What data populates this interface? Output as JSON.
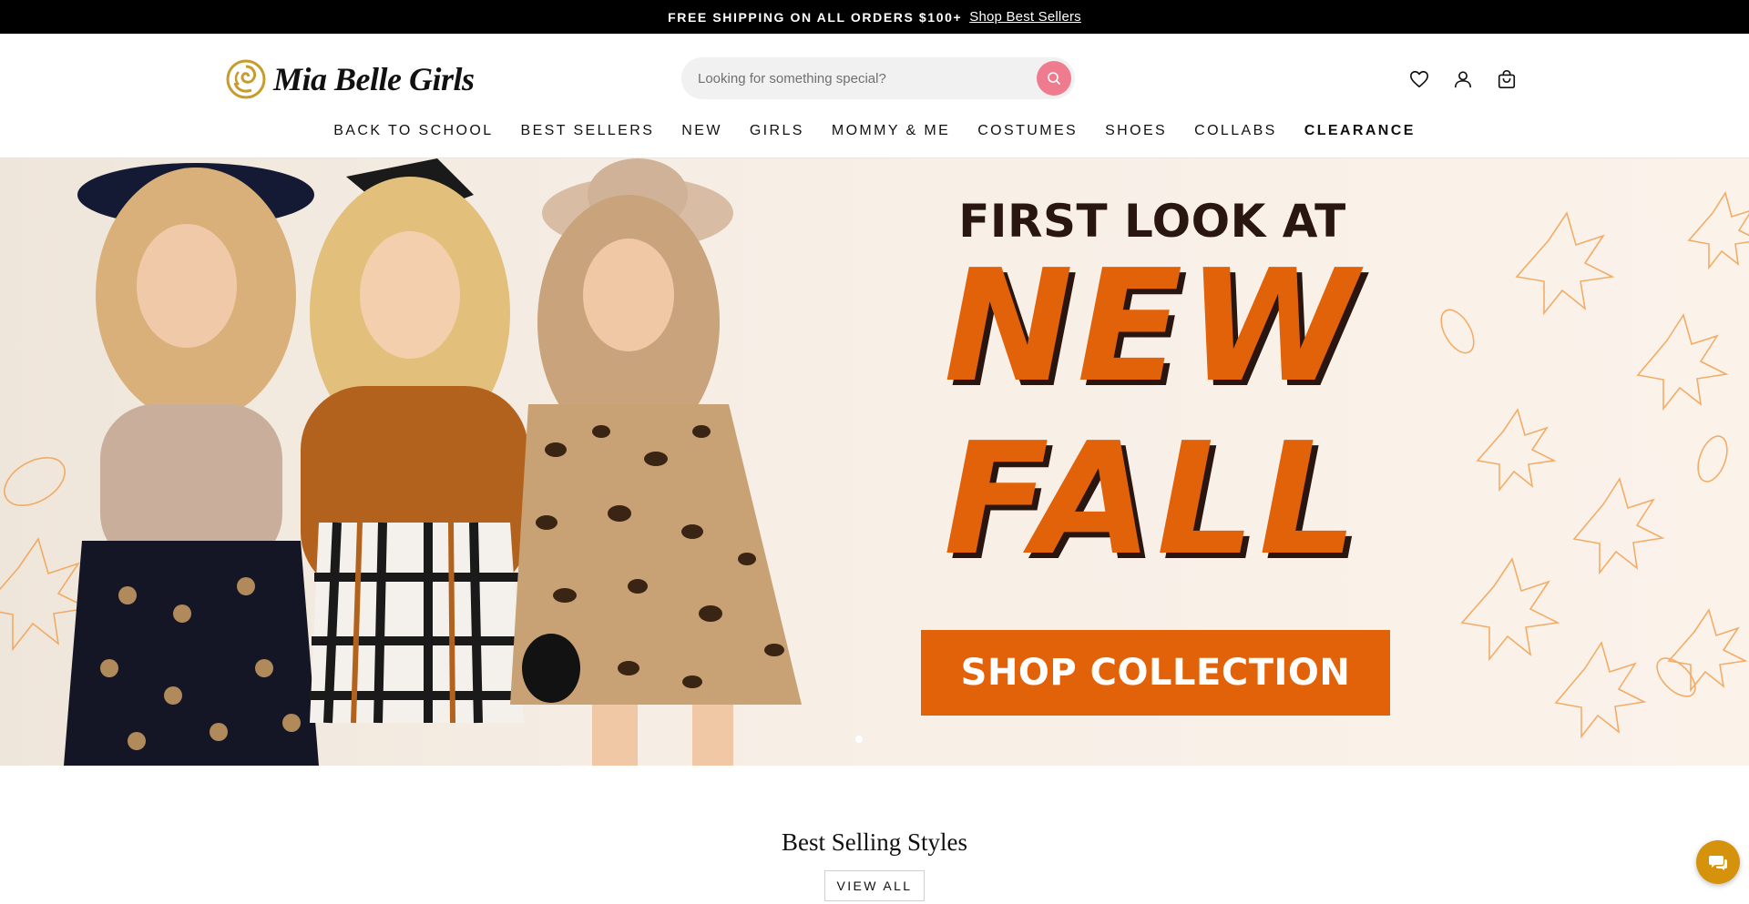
{
  "announcement": {
    "message": "FREE SHIPPING ON ALL ORDERS $100+",
    "link_label": "Shop Best Sellers"
  },
  "header": {
    "logo_text": "Mia Belle Girls",
    "search": {
      "placeholder": "Looking for something special?"
    },
    "icons": [
      "heart-icon",
      "account-icon",
      "cart-icon"
    ]
  },
  "nav": {
    "items": [
      {
        "label": "BACK TO SCHOOL"
      },
      {
        "label": "BEST SELLERS"
      },
      {
        "label": "NEW"
      },
      {
        "label": "GIRLS"
      },
      {
        "label": "MOMMY & ME"
      },
      {
        "label": "COSTUMES"
      },
      {
        "label": "SHOES"
      },
      {
        "label": "COLLABS"
      },
      {
        "label": "CLEARANCE"
      }
    ]
  },
  "hero": {
    "kicker": "FIRST LOOK AT",
    "line1": "NEW",
    "line2": "FALL",
    "cta": "SHOP COLLECTION"
  },
  "section": {
    "title": "Best Selling Styles",
    "view_all": "VIEW ALL"
  },
  "colors": {
    "accent": "#e2620a",
    "search_button": "#ef7c8e",
    "chat_button": "#d4920d",
    "text_dark": "#2a1610"
  }
}
